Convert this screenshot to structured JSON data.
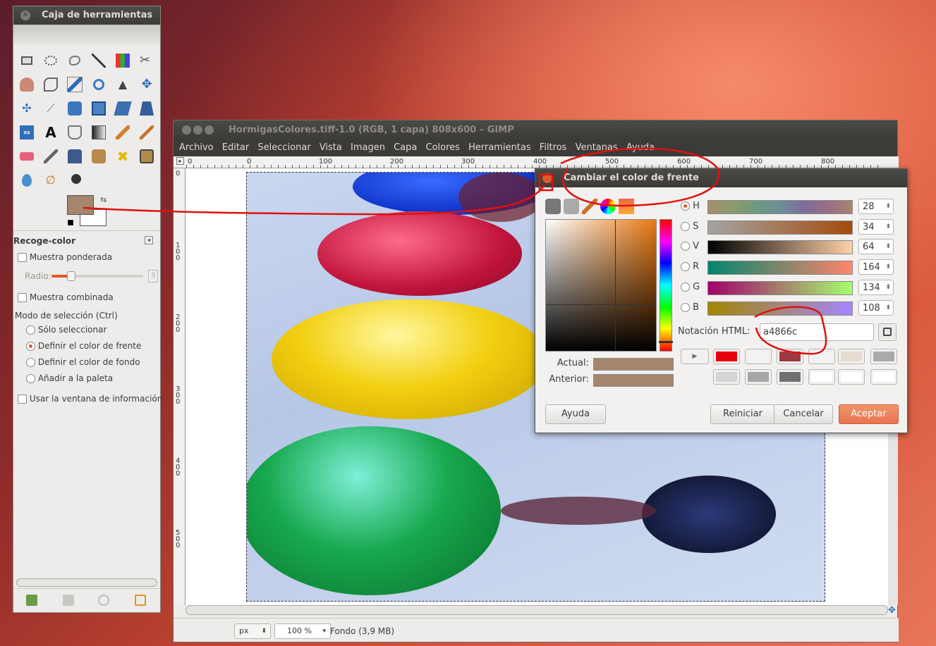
{
  "colors": {
    "foreground": "#a4866c",
    "accent": "#e0572c"
  },
  "toolbox": {
    "title": "Caja de herramientas",
    "tool_options": {
      "title": "Recoge-color",
      "sample_average": "Muestra ponderada",
      "radius_label": "Radio:",
      "radius_value": "3",
      "sample_merged": "Muestra combinada",
      "pick_mode_label": "Modo de selección  (Ctrl)",
      "modes": [
        "Sólo seleccionar",
        "Definir el color de frente",
        "Definir el color de fondo",
        "Añadir a la paleta"
      ],
      "selected_mode": "Definir el color de frente",
      "use_info_window": "Usar la ventana de información"
    }
  },
  "image_window": {
    "title": "HormigasColores.tiff-1.0 (RGB, 1 capa) 808x600 – GIMP",
    "menu": [
      "Archivo",
      "Editar",
      "Seleccionar",
      "Vista",
      "Imagen",
      "Capa",
      "Colores",
      "Herramientas",
      "Filtros",
      "Ventanas",
      "Ayuda"
    ],
    "ruler_h": [
      "0",
      "0",
      "100",
      "200",
      "300",
      "400",
      "500",
      "600",
      "700",
      "800"
    ],
    "ruler_v": [
      "0",
      "1 0 0",
      "2 0 0",
      "3 0 0",
      "4 0 0",
      "5 0 0"
    ],
    "status": {
      "unit": "px",
      "zoom": "100 %",
      "layer": "Fondo (3,9 MB)"
    }
  },
  "dialog": {
    "title": "Cambiar el color de frente",
    "channels": [
      {
        "name": "H",
        "value": "28",
        "selected": true
      },
      {
        "name": "S",
        "value": "34",
        "selected": false
      },
      {
        "name": "V",
        "value": "64",
        "selected": false
      },
      {
        "name": "R",
        "value": "164",
        "selected": false
      },
      {
        "name": "G",
        "value": "134",
        "selected": false
      },
      {
        "name": "B",
        "value": "108",
        "selected": false
      }
    ],
    "html_label": "Notación HTML:",
    "html_value": "a4866c",
    "current_label": "Actual:",
    "previous_label": "Anterior:",
    "history_colors": [
      "#e8000e",
      "#f2f2f2",
      "#9c3a40",
      "#f2f2f2",
      "#e8dcd0",
      "#aaaaaa",
      "#d4d4d4",
      "#a6a6a6",
      "#707070",
      "#ffffff",
      "#ffffff",
      "#ffffff"
    ],
    "buttons": {
      "help": "Ayuda",
      "reset": "Reiniciar",
      "cancel": "Cancelar",
      "ok": "Aceptar"
    }
  }
}
